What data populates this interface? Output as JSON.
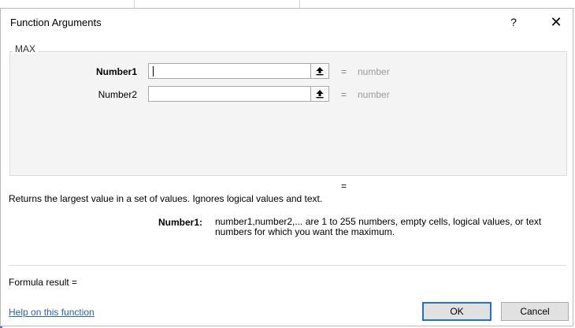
{
  "dialog": {
    "title": "Function Arguments",
    "help_glyph": "?",
    "close_glyph": "✕"
  },
  "function": {
    "name": "MAX",
    "arguments": [
      {
        "label": "Number1",
        "bold": true,
        "value": "",
        "equals": "=",
        "result": "number"
      },
      {
        "label": "Number2",
        "bold": false,
        "value": "",
        "equals": "=",
        "result": "number"
      }
    ],
    "result_equals": "=",
    "description": "Returns the largest value in a set of values. Ignores logical values and text.",
    "arg_help_label": "Number1:",
    "arg_help_text": "number1,number2,... are 1 to 255 numbers, empty cells, logical values, or text numbers for which you want the maximum."
  },
  "footer": {
    "formula_result": "Formula result =",
    "help_link": "Help on this function",
    "ok_label": "OK",
    "cancel_label": "Cancel"
  },
  "icons": {
    "ref_button": "collapse-dialog-arrow-icon"
  }
}
